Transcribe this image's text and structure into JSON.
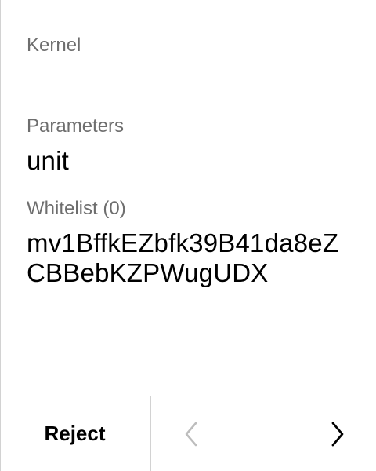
{
  "screen": {
    "section_title": "Kernel",
    "fields": [
      {
        "label": "Parameters",
        "value": "unit"
      },
      {
        "label": "Whitelist (0)",
        "value": "mv1BffkEZbfk39B41da8eZCBBebKZPWugUDX"
      }
    ]
  },
  "footer": {
    "reject_label": "Reject",
    "prev_icon": "chevron-left-icon",
    "next_icon": "chevron-right-icon",
    "prev_disabled": true,
    "colors": {
      "active_icon": "#000000",
      "disabled_icon": "#bdbdbd",
      "divider": "#d2d2d2",
      "label": "#6e6e6e"
    }
  }
}
